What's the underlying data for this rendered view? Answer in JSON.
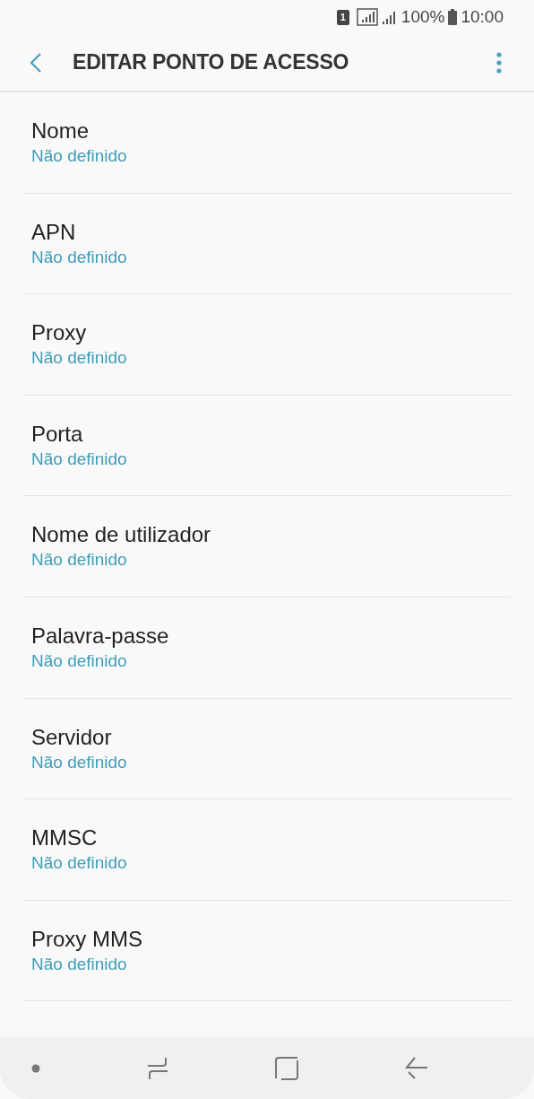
{
  "status_bar": {
    "sim_slot": "1",
    "battery": "100%",
    "time": "10:00"
  },
  "header": {
    "title": "EDITAR PONTO DE ACESSO"
  },
  "settings": [
    {
      "label": "Nome",
      "value": "Não definido"
    },
    {
      "label": "APN",
      "value": "Não definido"
    },
    {
      "label": "Proxy",
      "value": "Não definido"
    },
    {
      "label": "Porta",
      "value": "Não definido"
    },
    {
      "label": "Nome de utilizador",
      "value": "Não definido"
    },
    {
      "label": "Palavra-passe",
      "value": "Não definido"
    },
    {
      "label": "Servidor",
      "value": "Não definido"
    },
    {
      "label": "MMSC",
      "value": "Não definido"
    },
    {
      "label": "Proxy MMS",
      "value": "Não definido"
    }
  ]
}
